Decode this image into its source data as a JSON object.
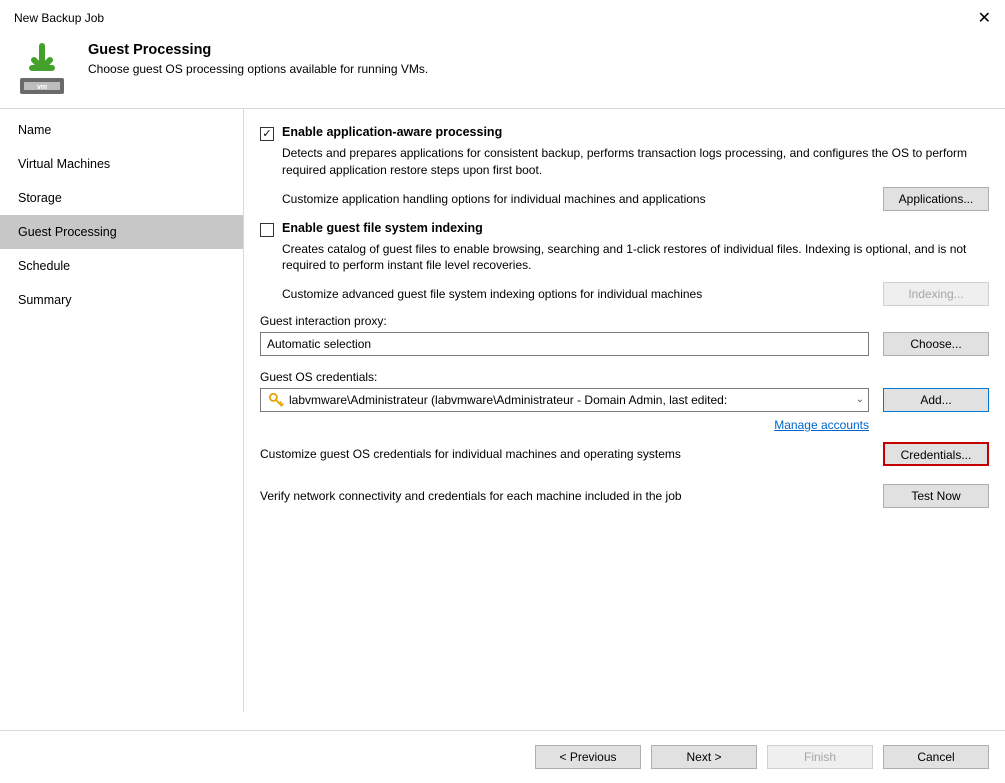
{
  "window": {
    "title": "New Backup Job"
  },
  "header": {
    "title": "Guest Processing",
    "desc": "Choose guest OS processing options available for running VMs."
  },
  "sidebar": {
    "items": [
      {
        "label": "Name"
      },
      {
        "label": "Virtual Machines"
      },
      {
        "label": "Storage"
      },
      {
        "label": "Guest Processing"
      },
      {
        "label": "Schedule"
      },
      {
        "label": "Summary"
      }
    ],
    "active_index": 3
  },
  "content": {
    "aap": {
      "title": "Enable application-aware processing",
      "desc": "Detects and prepares applications for consistent backup, performs transaction logs processing, and configures the OS to perform required application restore steps upon first boot.",
      "customize_text": "Customize application handling options for individual machines and applications",
      "applications_btn": "Applications..."
    },
    "indexing": {
      "title": "Enable guest file system indexing",
      "desc": "Creates catalog of guest files to enable browsing, searching and 1-click restores of individual files. Indexing is optional, and is not required to perform instant file level recoveries.",
      "customize_text": "Customize advanced guest file system indexing options for individual machines",
      "indexing_btn": "Indexing..."
    },
    "proxy": {
      "label": "Guest interaction proxy:",
      "value": "Automatic selection",
      "choose_btn": "Choose..."
    },
    "credentials": {
      "label": "Guest OS credentials:",
      "value": "labvmware\\Administrateur (labvmware\\Administrateur - Domain Admin, last edited:",
      "add_btn": "Add...",
      "manage_link": "Manage accounts"
    },
    "per_machine": {
      "text": "Customize guest OS credentials for individual machines and operating systems",
      "btn": "Credentials..."
    },
    "verify": {
      "text": "Verify network connectivity and credentials for each machine included in the job",
      "btn": "Test Now"
    }
  },
  "footer": {
    "previous": "< Previous",
    "next": "Next >",
    "finish": "Finish",
    "cancel": "Cancel"
  }
}
